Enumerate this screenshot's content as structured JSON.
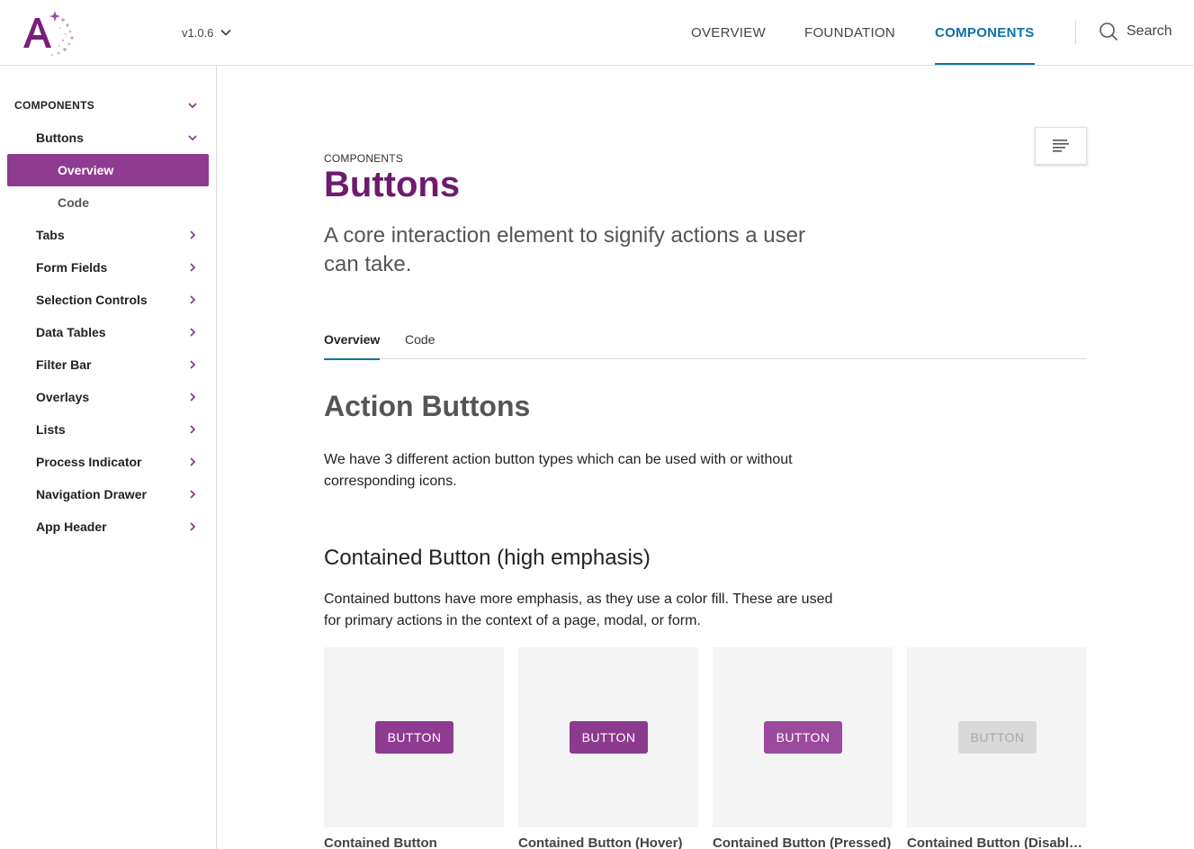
{
  "header": {
    "version": "v1.0.6",
    "nav": [
      "OVERVIEW",
      "FOUNDATION",
      "COMPONENTS"
    ],
    "active_nav": "COMPONENTS",
    "search_label": "Search"
  },
  "colors": {
    "brand_purple": "#6e1a6e",
    "active_purple": "#8e3b91",
    "link_blue": "#0b72a8",
    "disabled_gray": "#d9d9d9"
  },
  "sidebar": {
    "section": "COMPONENTS",
    "items": [
      {
        "label": "Buttons",
        "expanded": true
      },
      {
        "label": "Overview",
        "active": true
      },
      {
        "label": "Code"
      },
      {
        "label": "Tabs"
      },
      {
        "label": "Form Fields"
      },
      {
        "label": "Selection Controls"
      },
      {
        "label": "Data Tables"
      },
      {
        "label": "Filter Bar"
      },
      {
        "label": "Overlays"
      },
      {
        "label": "Lists"
      },
      {
        "label": "Process Indicator"
      },
      {
        "label": "Navigation Drawer"
      },
      {
        "label": "App Header"
      }
    ]
  },
  "main": {
    "eyebrow": "COMPONENTS",
    "title": "Buttons",
    "lede": "A core interaction element to signify actions a user can take.",
    "tabs": [
      "Overview",
      "Code"
    ],
    "section_title": "Action Buttons",
    "section_intro": "We have 3 different action button types which can be used with or without corresponding icons.",
    "subsection_title": "Contained Button (high emphasis)",
    "subsection_body": "Contained buttons have more emphasis, as they use a color fill. These are used for primary actions in the context of a page, modal, or form.",
    "examples": [
      {
        "button": "BUTTON",
        "caption": "Contained Button",
        "state": "default"
      },
      {
        "button": "BUTTON",
        "caption": "Contained Button (Hover)",
        "state": "hover"
      },
      {
        "button": "BUTTON",
        "caption": "Contained Button (Pressed)",
        "state": "pressed"
      },
      {
        "button": "BUTTON",
        "caption": "Contained Button (Disabled)",
        "state": "disabled"
      }
    ]
  }
}
